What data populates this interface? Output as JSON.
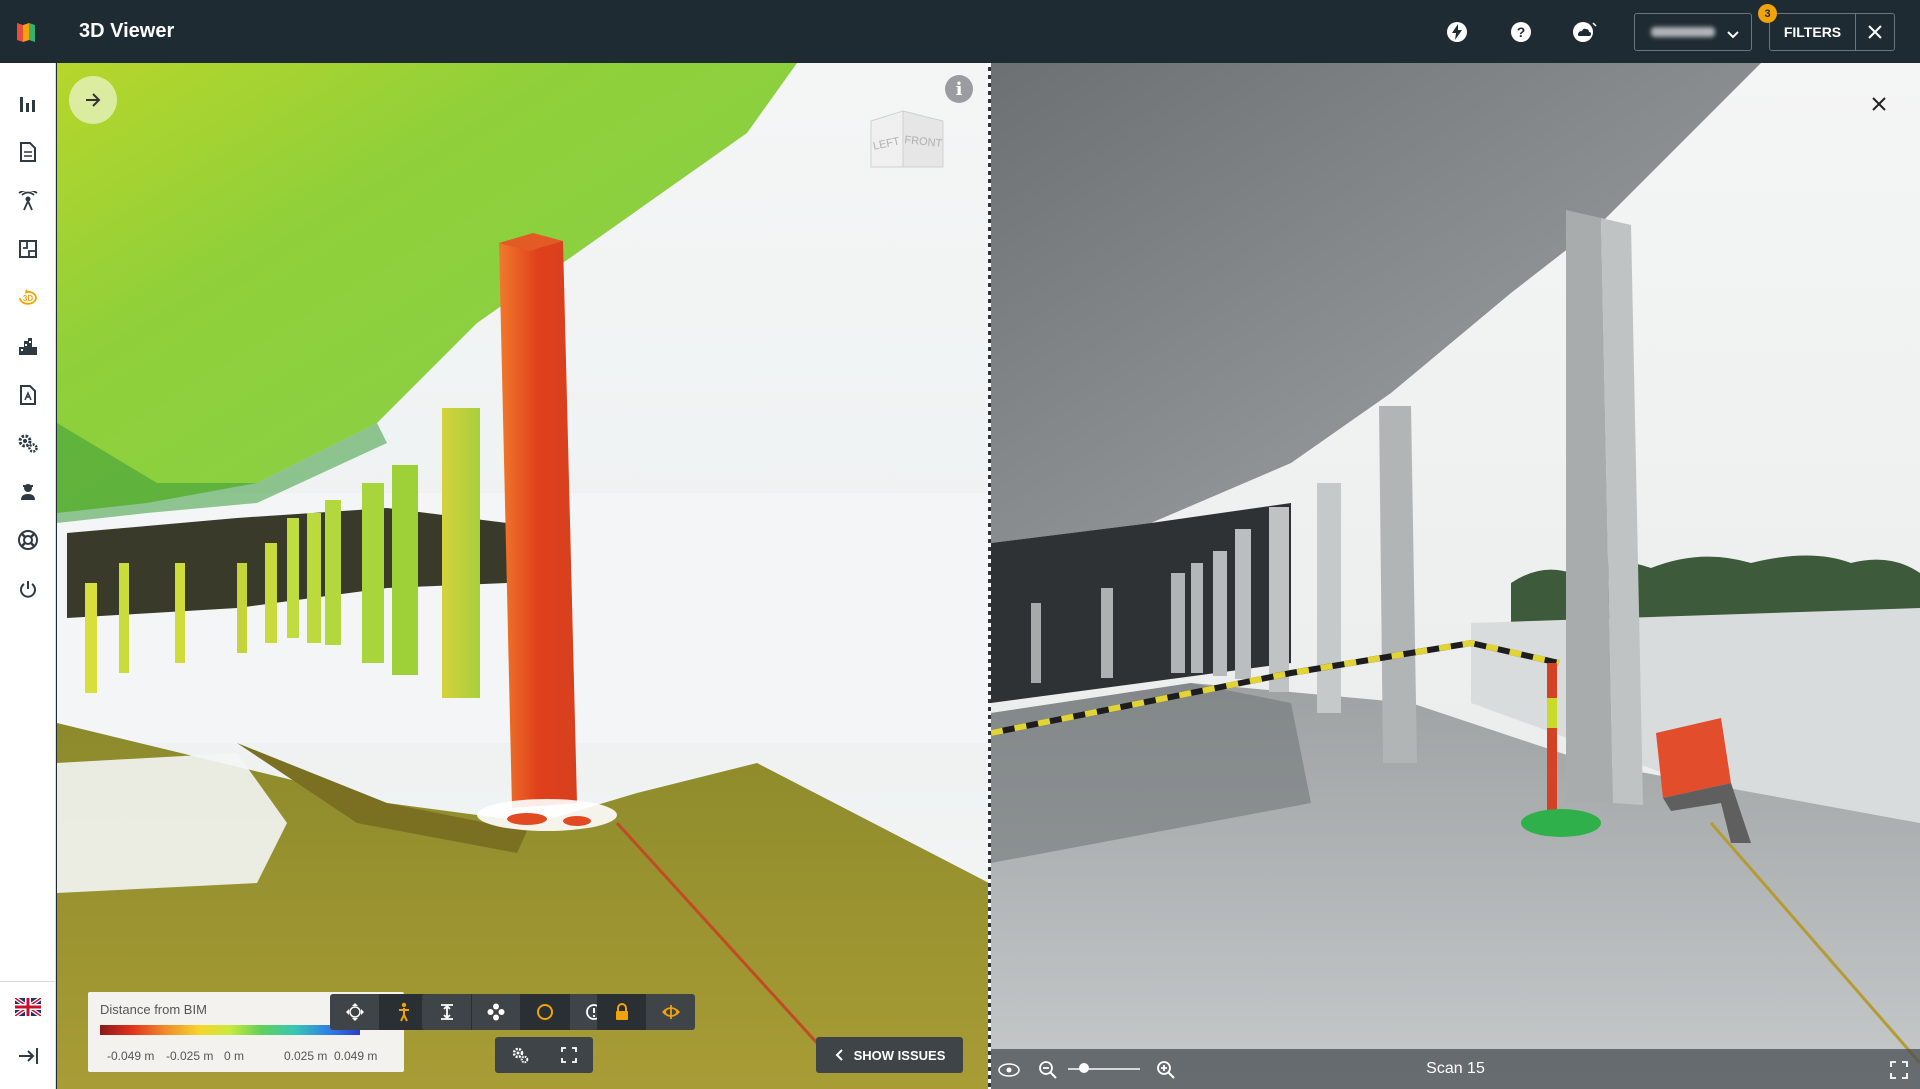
{
  "app": {
    "title": "3D Viewer"
  },
  "header": {
    "filters_label": "FILTERS",
    "filters_badge": "3",
    "icons": [
      "lightning-icon",
      "help-icon",
      "cloud-sync-icon"
    ]
  },
  "sidebar": {
    "items": [
      {
        "icon": "bar-chart-icon"
      },
      {
        "icon": "document-icon"
      },
      {
        "icon": "scanner-icon"
      },
      {
        "icon": "floorplan-icon"
      },
      {
        "icon": "3d-rotate-icon",
        "active": true
      },
      {
        "icon": "building-icon"
      },
      {
        "icon": "pdf-icon"
      },
      {
        "icon": "settings-icon"
      },
      {
        "icon": "user-icon"
      },
      {
        "icon": "support-icon"
      },
      {
        "icon": "power-icon"
      }
    ],
    "bottom": [
      {
        "icon": "uk-flag-icon"
      },
      {
        "icon": "collapse-sidebar-icon"
      }
    ],
    "active_color": "#f0a30a"
  },
  "viewer": {
    "view_cube": {
      "left": "LEFT",
      "front": "FRONT"
    },
    "legend": {
      "title": "Distance from BIM",
      "ticks": [
        "-0.049 m",
        "-0.025 m",
        "0 m",
        "0.025 m",
        "0.049 m"
      ]
    },
    "show_issues_label": "SHOW ISSUES",
    "accent": "#f0a30a"
  },
  "photo": {
    "scan_label": "Scan 15"
  }
}
